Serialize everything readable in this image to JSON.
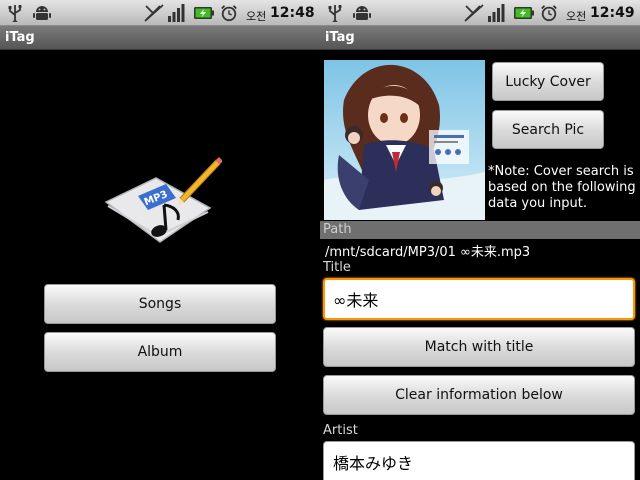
{
  "left": {
    "status": {
      "ampm": "오전",
      "time": "12:48"
    },
    "title": "iTag",
    "buttons": {
      "songs": "Songs",
      "album": "Album"
    },
    "logo_text": "MP3"
  },
  "right": {
    "status": {
      "ampm": "오전",
      "time": "12:49"
    },
    "title": "iTag",
    "buttons": {
      "lucky_cover": "Lucky Cover",
      "search_pic": "Search Pic",
      "match_title": "Match with title",
      "clear_info": "Clear information below"
    },
    "note_lines": [
      "*Note: Cover search is",
      "based on the following",
      "data you input."
    ],
    "path_label": "Path",
    "path_value": "/mnt/sdcard/MP3/01 ∞未来.mp3",
    "title_label": "Title",
    "title_value": "∞未来",
    "artist_label": "Artist",
    "artist_value": "橋本みゆき"
  },
  "colors": {
    "status_bar": "#c8c8c8",
    "title_bar": "#6a6a6a",
    "focus_border": "#ff9500",
    "battery_green": "#3fbf1f"
  },
  "icons": [
    "usb-icon",
    "android-debug-icon",
    "signal-off-icon",
    "signal-bars-icon",
    "battery-charging-icon",
    "alarm-clock-icon",
    "mp3-note-logo-icon",
    "album-cover-image"
  ]
}
